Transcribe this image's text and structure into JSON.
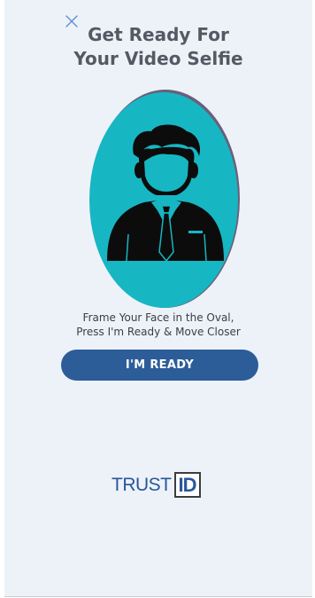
{
  "title_lines": [
    "Get Ready For",
    "Your Video Selfie"
  ],
  "instructions_lines": [
    "Frame Your Face in the Oval,",
    "Press I'm Ready & Move Closer"
  ],
  "ready_button_label": "I'M READY",
  "logo": {
    "trust_text": "TRUST",
    "id_text": "ID"
  },
  "icons": {
    "close": "close-icon",
    "avatar": "person-avatar-icon"
  },
  "colors": {
    "background": "#edf2f9",
    "oval": "#17b6c3",
    "button": "#2c5d98",
    "logo_blue": "#27579a",
    "title_text": "#535a63"
  }
}
